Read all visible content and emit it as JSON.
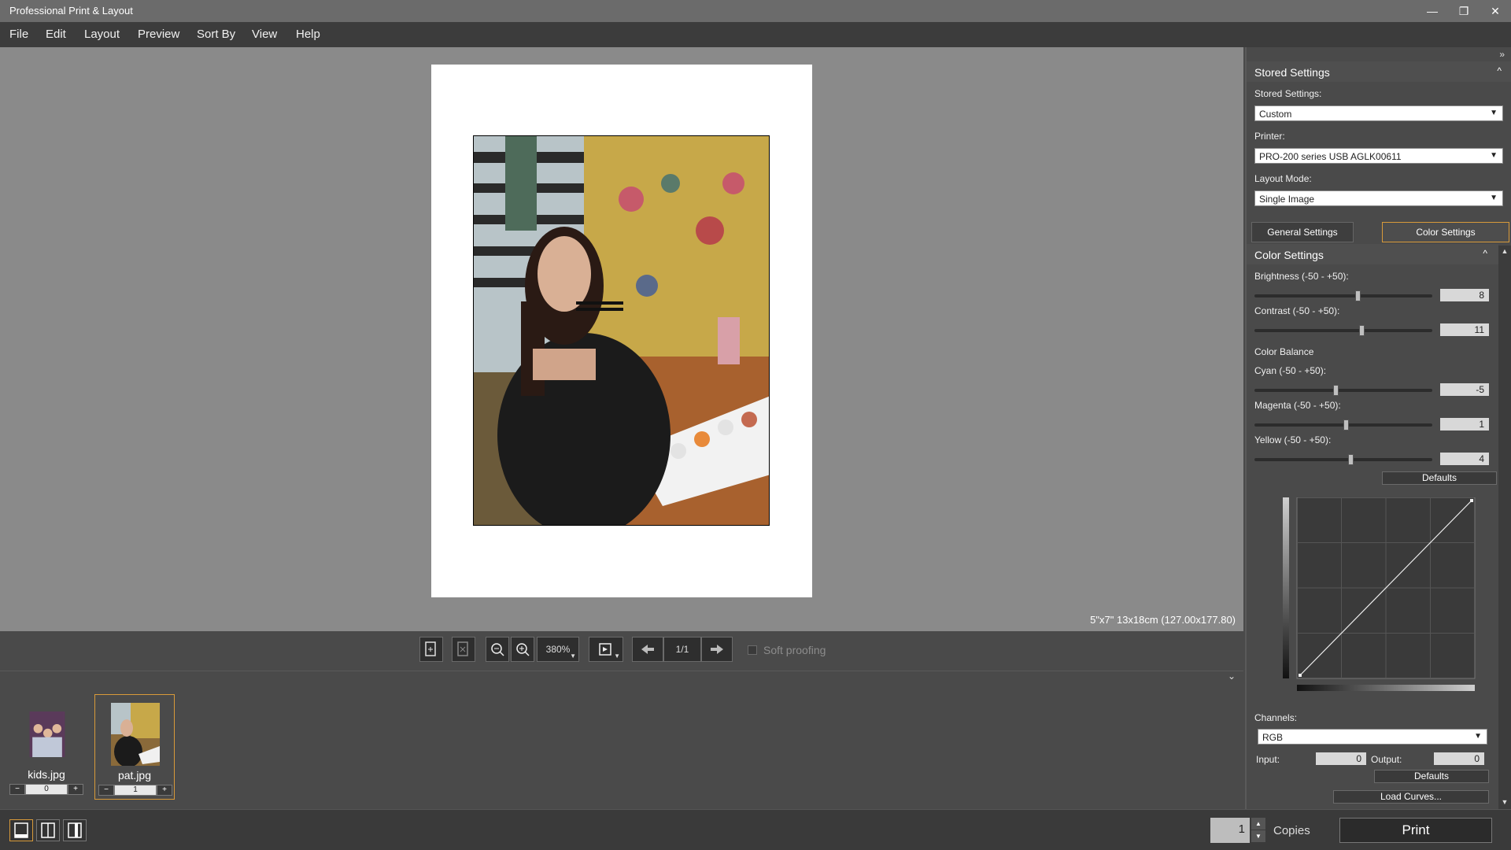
{
  "app": {
    "title": "Professional Print & Layout",
    "window_controls": {
      "minimize": "—",
      "restore": "❐",
      "close": "✕"
    }
  },
  "menu": [
    "File",
    "Edit",
    "Layout",
    "Preview",
    "Sort By",
    "View",
    "Help"
  ],
  "canvas": {
    "paper_size_label": "5\"x7\" 13x18cm (127.00x177.80)"
  },
  "toolbar": {
    "zoom_value": "380%",
    "page_indicator": "1/1",
    "soft_proofing_label": "Soft proofing",
    "soft_proofing_checked": false
  },
  "thumbnails": [
    {
      "name": "kids.jpg",
      "copies": "0",
      "selected": false
    },
    {
      "name": "pat.jpg",
      "copies": "1",
      "selected": true
    }
  ],
  "stepper": {
    "minus": "−",
    "plus": "+"
  },
  "status": {
    "copies_value": "1",
    "copies_label": "Copies",
    "print_label": "Print"
  },
  "panel": {
    "stored_settings_header": "Stored Settings",
    "stored_settings_label": "Stored Settings:",
    "stored_settings_value": "Custom",
    "printer_label": "Printer:",
    "printer_value": "PRO-200 series USB AGLK00611",
    "layout_mode_label": "Layout Mode:",
    "layout_mode_value": "Single Image",
    "tabs": [
      "General Settings",
      "Color Settings"
    ],
    "color_settings_header": "Color Settings",
    "brightness_label": "Brightness (-50 - +50):",
    "brightness_value": "8",
    "contrast_label": "Contrast (-50 - +50):",
    "contrast_value": "11",
    "color_balance_label": "Color Balance",
    "cyan_label": "Cyan (-50 - +50):",
    "cyan_value": "-5",
    "magenta_label": "Magenta (-50 - +50):",
    "magenta_value": "1",
    "yellow_label": "Yellow (-50 - +50):",
    "yellow_value": "4",
    "defaults_label": "Defaults",
    "channels_label": "Channels:",
    "channels_value": "RGB",
    "input_label": "Input:",
    "input_value": "0",
    "output_label": "Output:",
    "output_value": "0",
    "curve_defaults_label": "Defaults",
    "load_curves_label": "Load Curves..."
  },
  "colors": {
    "accent": "#d89a3a",
    "canvas_bg": "#8a8a8a",
    "panel_bg": "#4a4a4a"
  }
}
